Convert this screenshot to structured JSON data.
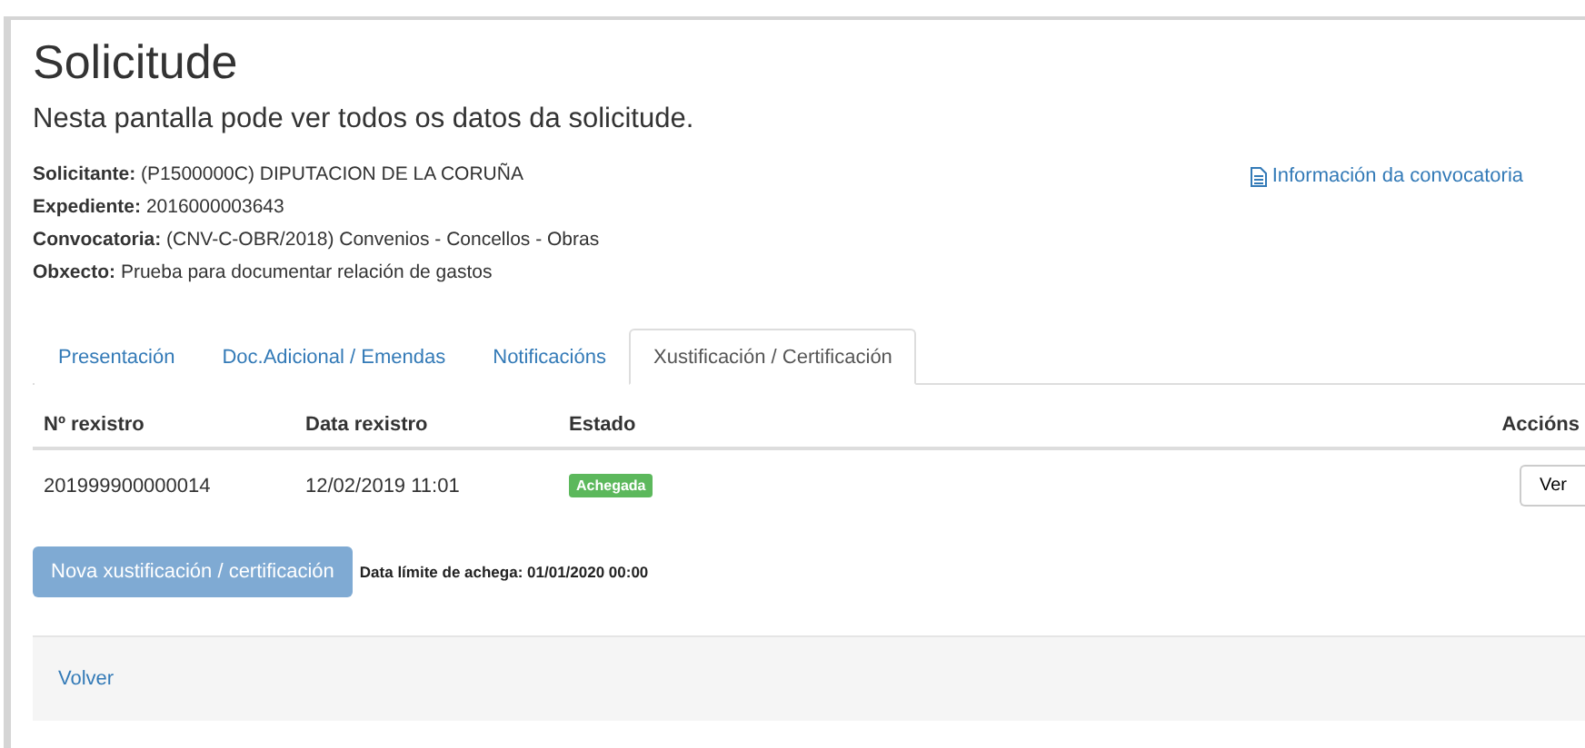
{
  "title": "Solicitude",
  "subtitle": "Nesta pantalla pode ver todos os datos da solicitude.",
  "details": [
    {
      "label": "Solicitante:",
      "value": "(P1500000C) DIPUTACION DE LA CORUÑA"
    },
    {
      "label": "Expediente:",
      "value": "2016000003643"
    },
    {
      "label": "Convocatoria:",
      "value": "(CNV-C-OBR/2018) Convenios - Concellos - Obras"
    },
    {
      "label": "Obxecto:",
      "value": "Prueba para documentar relación de gastos"
    }
  ],
  "info_link": "Información da convocatoria",
  "tabs": [
    {
      "label": "Presentación",
      "selected": false
    },
    {
      "label": "Doc.Adicional / Emendas",
      "selected": false
    },
    {
      "label": "Notificacións",
      "selected": false
    },
    {
      "label": "Xustificación / Certificación",
      "selected": true
    }
  ],
  "table": {
    "columns": [
      "Nº rexistro",
      "Data rexistro",
      "Estado",
      "Accións"
    ],
    "rows": [
      {
        "number": "201999900000014",
        "date": "12/02/2019 11:01",
        "status": "Achegada",
        "color": "#5cb85c",
        "action": "Ver"
      }
    ]
  },
  "new_button": {
    "label": "Nova xustificación / certificación",
    "disabled": true
  },
  "deadline": "Data límite de achega: 01/01/2020 00:00",
  "back_link": "Volver"
}
